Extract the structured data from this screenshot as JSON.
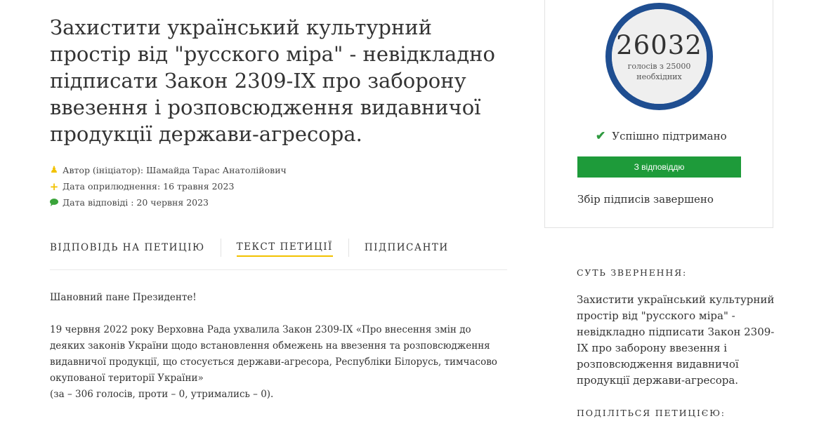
{
  "petition": {
    "title": "Захистити український культурний простір від \"русского міра\" - невідкладно підписати Закон 2309-IX про заборону ввезення і розповсюдження видавничої продукції держави-агресора.",
    "meta": {
      "author": "Автор (ініціатор): Шамайда Тарас Анатолійович",
      "published": "Дата оприлюднення: 16 травня 2023",
      "answered": "Дата відповіді : 20 червня 2023"
    }
  },
  "tabs": [
    {
      "label": "ВІДПОВІДЬ НА ПЕТИЦІЮ",
      "active": false
    },
    {
      "label": "ТЕКСТ ПЕТИЦІЇ",
      "active": true
    },
    {
      "label": "ПІДПИСАНТИ",
      "active": false
    }
  ],
  "body": {
    "greeting": "Шановний пане Президенте!",
    "paragraph1_line1": "19 червня 2022 року Верховна Рада ухвалила Закон 2309-IX «Про внесення змін до деяких законів України щодо встановлення обмежень на ввезення та розповсюдження видавничої продукції, що стосується держави-агресора, Республіки Білорусь, тимчасово окупованої території України»",
    "paragraph1_line2": "(за – 306 голосів, проти – 0, утримались – 0)."
  },
  "sidebar": {
    "count": "26032",
    "count_caption": "голосів з 25000 необхідних",
    "progress_fraction": 1.0,
    "status": "Успішно підтримано",
    "answer_button": "З відповіддю",
    "closed": "Збір підписів завершено",
    "summary_heading": "СУТЬ ЗВЕРНЕННЯ:",
    "summary_text": "Захистити український культурний простір від \"русского міра\" - невідкладно підписати Закон 2309-IX про заборону ввезення і розповсюдження видавничої продукції держави-агресора.",
    "share_heading": "ПОДІЛІТЬСЯ ПЕТИЦІЄЮ:"
  },
  "colors": {
    "accent_yellow": "#f2c200",
    "counter_ring": "#1f4e91",
    "success_green": "#1e9b3a"
  },
  "icons": {
    "author": "user-icon",
    "published": "plus-icon",
    "answered": "chat-icon",
    "status": "check-icon"
  }
}
